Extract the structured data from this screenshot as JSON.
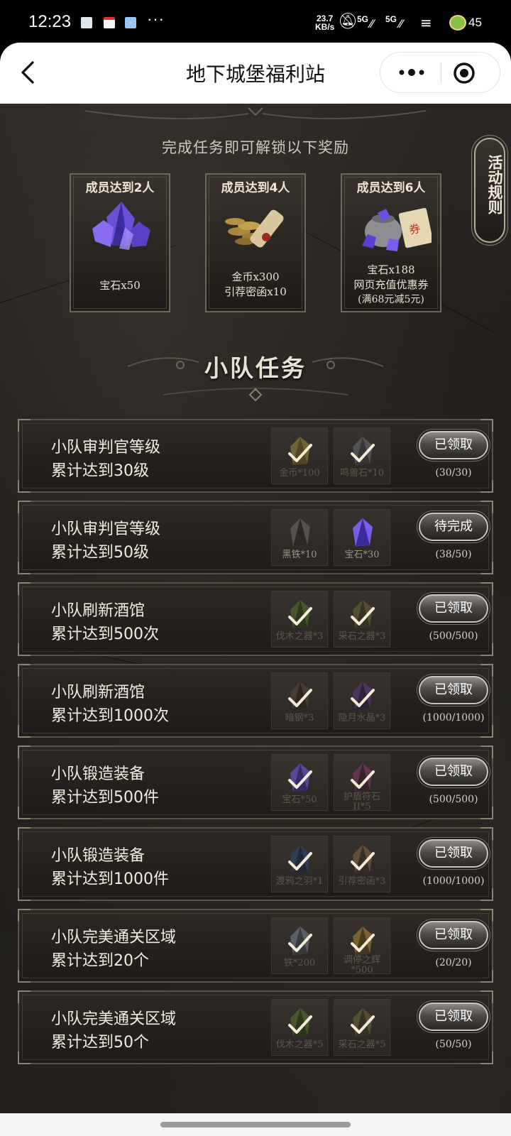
{
  "status_bar": {
    "time": "12:23",
    "more": "···",
    "net_speed_value": "23.7",
    "net_speed_unit": "KB/s",
    "signal_1": "5G",
    "signal_2": "5G",
    "battery": "45"
  },
  "header": {
    "title": "地下城堡福利站"
  },
  "intro": "完成任务即可解锁以下奖励",
  "rules_button": "活动规则",
  "rewards": [
    {
      "title": "成员达到2人",
      "lines": [
        "宝石x50"
      ],
      "art": "gem-cluster-icon"
    },
    {
      "title": "成员达到4人",
      "lines": [
        "金币x300",
        "引荐密函x10"
      ],
      "art": "coins-scroll-icon"
    },
    {
      "title": "成员达到6人",
      "lines": [
        "宝石x188",
        "网页充值优惠券",
        "(满68元减5元)"
      ],
      "art": "gems-bag-coupon-icon"
    }
  ],
  "section_title": "小队任务",
  "tasks": [
    {
      "line1": "小队审判官等级",
      "line2": "累计达到30级",
      "items": [
        {
          "label": "金币*100",
          "done": true,
          "icon": "coin-icon"
        },
        {
          "label": "鸣兽石*10",
          "done": true,
          "icon": "stone-icon"
        }
      ],
      "button": "已领取",
      "progress": "(30/30)"
    },
    {
      "line1": "小队审判官等级",
      "line2": "累计达到50级",
      "items": [
        {
          "label": "黑铁*10",
          "done": false,
          "icon": "black-iron-icon"
        },
        {
          "label": "宝石*30",
          "done": false,
          "icon": "gem-icon"
        }
      ],
      "button": "待完成",
      "progress": "(38/50)"
    },
    {
      "line1": "小队刷新酒馆",
      "line2": "累计达到500次",
      "items": [
        {
          "label": "伐木之器*3",
          "done": true,
          "icon": "axe-tool-icon"
        },
        {
          "label": "采石之器*3",
          "done": true,
          "icon": "pick-tool-icon"
        }
      ],
      "button": "已领取",
      "progress": "(500/500)"
    },
    {
      "line1": "小队刷新酒馆",
      "line2": "累计达到1000次",
      "items": [
        {
          "label": "暗钢*3",
          "done": true,
          "icon": "dark-steel-icon"
        },
        {
          "label": "隐月水晶*3",
          "done": true,
          "icon": "crystal-icon"
        }
      ],
      "button": "已领取",
      "progress": "(1000/1000)"
    },
    {
      "line1": "小队锻造装备",
      "line2": "累计达到500件",
      "items": [
        {
          "label": "宝石*50",
          "done": true,
          "icon": "gem-icon"
        },
        {
          "label": "护盾符石",
          "label2": "II*5",
          "done": true,
          "icon": "rune-stone-icon"
        }
      ],
      "button": "已领取",
      "progress": "(500/500)"
    },
    {
      "line1": "小队锻造装备",
      "line2": "累计达到1000件",
      "items": [
        {
          "label": "渡鸦之羽*1",
          "done": true,
          "icon": "feather-icon"
        },
        {
          "label": "引荐密函*3",
          "done": true,
          "icon": "letter-icon"
        }
      ],
      "button": "已领取",
      "progress": "(1000/1000)"
    },
    {
      "line1": "小队完美通关区域",
      "line2": "累计达到20个",
      "items": [
        {
          "label": "铁*200",
          "done": true,
          "icon": "iron-icon"
        },
        {
          "label": "调停之辉",
          "label2": "*500",
          "done": true,
          "icon": "radiance-icon"
        }
      ],
      "button": "已领取",
      "progress": "(20/20)"
    },
    {
      "line1": "小队完美通关区域",
      "line2": "累计达到50个",
      "items": [
        {
          "label": "伐木之器*5",
          "done": true,
          "icon": "axe-tool-icon"
        },
        {
          "label": "采石之器*5",
          "done": true,
          "icon": "pick-tool-icon"
        }
      ],
      "button": "已领取",
      "progress": "(50/50)"
    }
  ]
}
